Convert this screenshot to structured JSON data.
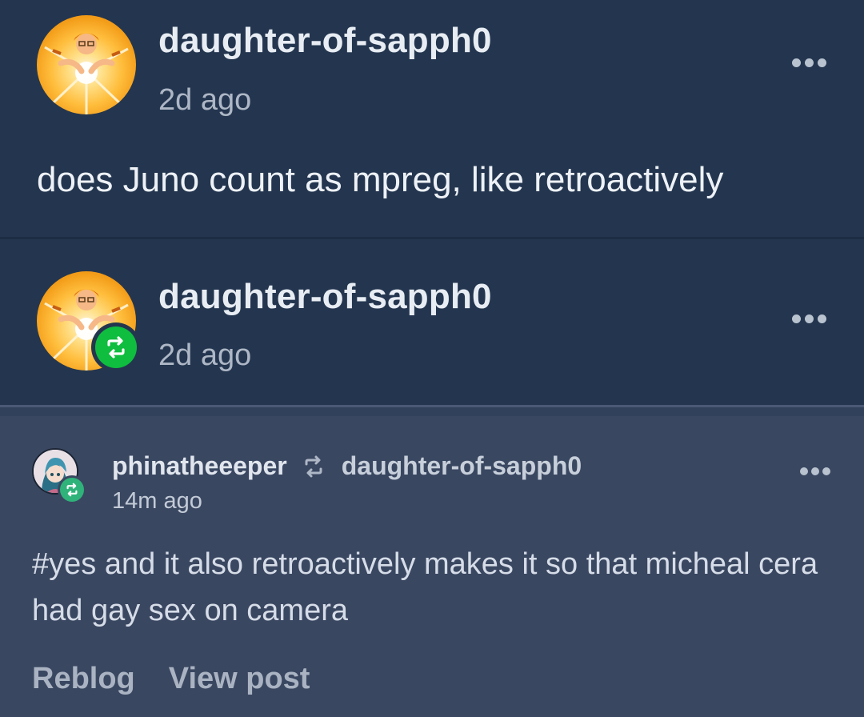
{
  "original_post": {
    "username": "daughter-of-sapph0",
    "timestamp": "2d ago",
    "text": "does Juno count as mpreg, like retroactively",
    "avatar_icon": "avatar-image",
    "menu_icon": "more-options-icon"
  },
  "reblog_header": {
    "username": "daughter-of-sapph0",
    "timestamp": "2d ago",
    "badge_icon": "reblog-icon",
    "badge_color": "#0fbd3f"
  },
  "activity": {
    "reblogger": "phinatheeeper",
    "reblogged_from": "daughter-of-sapph0",
    "timestamp": "14m ago",
    "tags_text": "#yes and it also retroactively makes it so that micheal cera had gay sex on camera",
    "badge_color": "#2fb37a",
    "actions": {
      "reblog": "Reblog",
      "view_post": "View post"
    }
  },
  "colors": {
    "post_bg": "#24364f",
    "panel_bg": "#3a4761",
    "text_primary": "#eef2f7",
    "text_secondary": "#aeb7c6"
  }
}
